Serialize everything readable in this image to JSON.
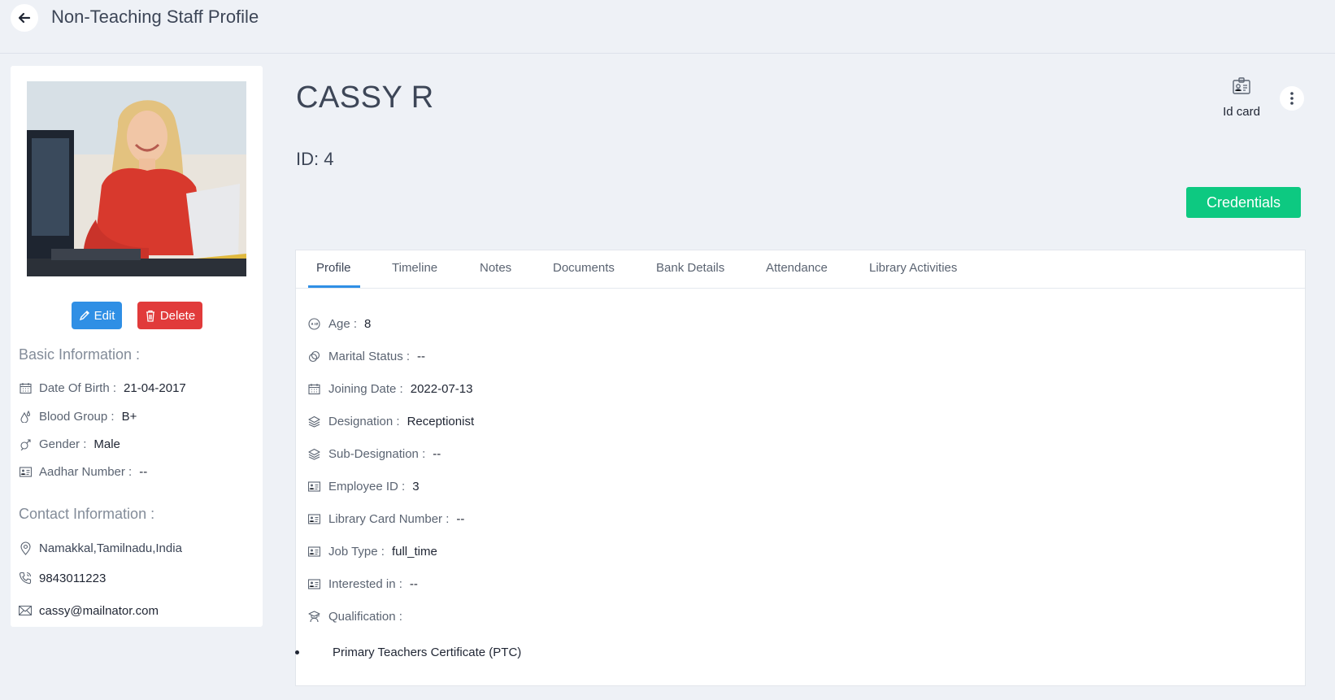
{
  "header": {
    "title": "Non-Teaching Staff Profile"
  },
  "profile": {
    "name": "CASSY R",
    "id_text": "ID: 4",
    "edit_label": "Edit",
    "delete_label": "Delete"
  },
  "basic_info": {
    "title": "Basic Information :",
    "rows": [
      {
        "label": "Date Of Birth :",
        "value": "21-04-2017"
      },
      {
        "label": "Blood Group :",
        "value": "B+"
      },
      {
        "label": "Gender :",
        "value": "Male"
      },
      {
        "label": "Aadhar Number :",
        "value": "--"
      }
    ]
  },
  "contact_info": {
    "title": "Contact Information :",
    "address": "Namakkal,Tamilnadu,India",
    "phone": "9843011223",
    "email": "cassy@mailnator.com"
  },
  "actions": {
    "id_card_label": "Id card",
    "credentials_label": "Credentials"
  },
  "tabs": [
    {
      "label": "Profile"
    },
    {
      "label": "Timeline"
    },
    {
      "label": "Notes"
    },
    {
      "label": "Documents"
    },
    {
      "label": "Bank Details"
    },
    {
      "label": "Attendance"
    },
    {
      "label": "Library Activities"
    }
  ],
  "details": [
    {
      "label": "Age :",
      "value": "8"
    },
    {
      "label": "Marital Status :",
      "value": "--"
    },
    {
      "label": "Joining Date :",
      "value": "2022-07-13"
    },
    {
      "label": "Designation :",
      "value": "Receptionist"
    },
    {
      "label": "Sub-Designation :",
      "value": "--"
    },
    {
      "label": "Employee ID :",
      "value": "3"
    },
    {
      "label": "Library Card Number :",
      "value": "--"
    },
    {
      "label": "Job Type :",
      "value": "full_time"
    },
    {
      "label": "Interested in :",
      "value": "--"
    },
    {
      "label": "Qualification :",
      "value": ""
    }
  ],
  "qualifications": [
    "Primary Teachers Certificate (PTC)"
  ],
  "colors": {
    "primary": "#2f8fe5",
    "danger": "#e13b3b",
    "success": "#0dc981",
    "background": "#eef1f6"
  }
}
